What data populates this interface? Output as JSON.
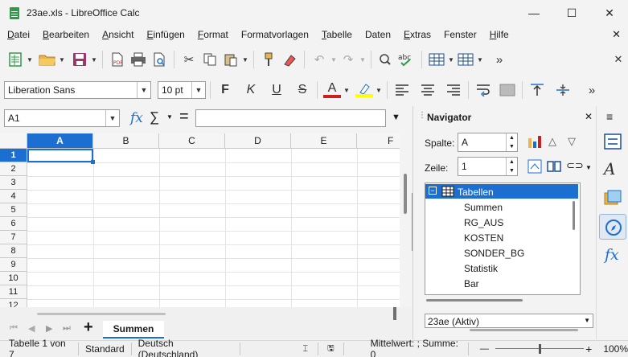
{
  "window": {
    "title": "23ae.xls - LibreOffice Calc",
    "controls": [
      "—",
      "☐",
      "✕"
    ]
  },
  "menubar": {
    "items": [
      {
        "u": "D",
        "rest": "atei"
      },
      {
        "u": "B",
        "rest": "earbeiten"
      },
      {
        "u": "A",
        "rest": "nsicht"
      },
      {
        "u": "E",
        "rest": "infügen"
      },
      {
        "u": "F",
        "rest": "ormat"
      },
      {
        "u": "",
        "rest": "Formatvorlagen"
      },
      {
        "u": "T",
        "rest": "abelle"
      },
      {
        "u": "",
        "rest": "Daten"
      },
      {
        "u": "E",
        "rest": "xtras"
      },
      {
        "u": "",
        "rest": "Fenster"
      },
      {
        "u": "H",
        "rest": "ilfe"
      }
    ],
    "close": "✕"
  },
  "format_toolbar": {
    "font_name": "Liberation Sans",
    "font_size": "10 pt",
    "bold": "F",
    "italic": "K",
    "underline": "U",
    "strike": "S",
    "font_color": "A",
    "font_color_hex": "#c9211e",
    "highlight_hex": "#ffff00"
  },
  "formula_bar": {
    "name_box": "A1",
    "fx": "fx",
    "sigma": "∑",
    "equals": "=",
    "input_value": ""
  },
  "grid": {
    "columns": [
      "A",
      "B",
      "C",
      "D",
      "E",
      "F"
    ],
    "rows": [
      "1",
      "2",
      "3",
      "4",
      "5",
      "6",
      "7",
      "8",
      "9",
      "10",
      "11",
      "12"
    ],
    "active_cell": "A1",
    "accent": "#1c6fd1"
  },
  "sheet_tabs": {
    "add": "+",
    "tabs": [
      "Summen"
    ],
    "active": "Summen"
  },
  "statusbar": {
    "sheet_info": "Tabelle 1 von 7",
    "page_style": "Standard",
    "language": "Deutsch (Deutschland)",
    "summary": "Mittelwert: ; Summe: 0",
    "zoom_minus": "—",
    "zoom_plus": "+",
    "zoom": "100%",
    "zoom_level_percent": 100
  },
  "navigator": {
    "title": "Navigator",
    "column_label": "Spalte:",
    "column_value": "A",
    "row_label": "Zeile:",
    "row_value": "1",
    "tree_root": "Tabellen",
    "tree_items": [
      "Summen",
      "RG_AUS",
      "KOSTEN",
      "SONDER_BG",
      "Statistik",
      "Bar"
    ],
    "document": "23ae (Aktiv)",
    "close": "✕",
    "menu": "≡"
  }
}
